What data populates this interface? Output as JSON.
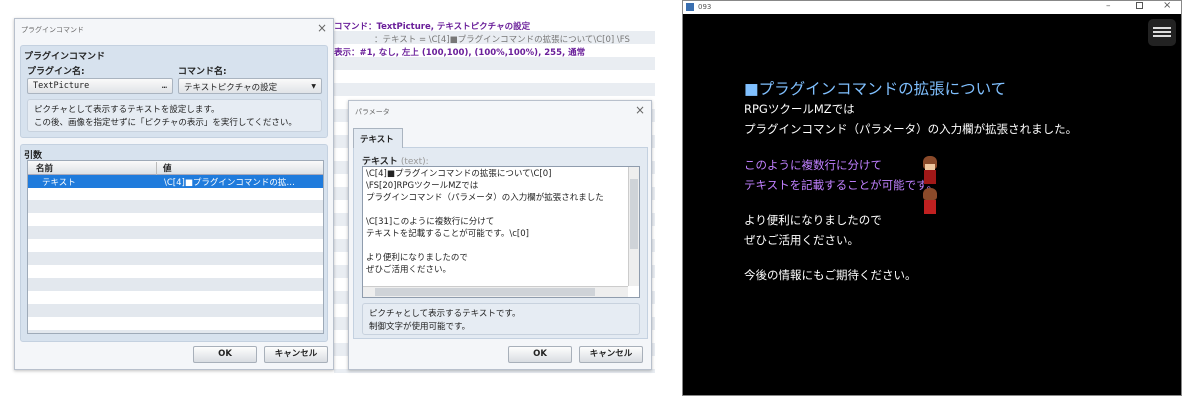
{
  "editor_bg": {
    "lines": [
      "コマンド：TextPicture, テキストピクチャの設定",
      "：テキスト = \\C[4]■プラグインコマンドの拡張について\\C[0] \\FS",
      "表示：#1, なし, 左上 (100,100), (100%,100%), 255, 通常"
    ]
  },
  "plugin_dialog": {
    "title": "プラグインコマンド",
    "section_title": "プラグインコマンド",
    "plugin_label": "プラグイン名:",
    "plugin_value": "TextPicture",
    "plugin_button": "…",
    "command_label": "コマンド名:",
    "command_value": "テキストピクチャの設定",
    "description": [
      "ピクチャとして表示するテキストを設定します。",
      "この後、画像を指定せずに「ピクチャの表示」を実行してください。"
    ],
    "args_title": "引数",
    "columns": [
      "名前",
      "値"
    ],
    "rows": [
      {
        "name": "テキスト",
        "value": "\\C[4]■プラグインコマンドの拡…"
      }
    ],
    "ok": "OK",
    "cancel": "キャンセル"
  },
  "param_dialog": {
    "title": "パラメータ",
    "tab": "テキスト",
    "field_label": "テキスト",
    "field_key": "(text):",
    "text_lines": [
      "\\C[4]■プラグインコマンドの拡張について\\C[0]",
      "\\FS[20]RPGツクールMZでは",
      "プラグインコマンド（パラメータ）の入力欄が拡張されました",
      "",
      "\\C[31]このように複数行に分けて",
      "テキストを記載することが可能です。\\c[0]",
      "",
      "より便利になりましたので",
      "ぜひご活用ください。"
    ],
    "description": [
      "ピクチャとして表示するテキストです。",
      "制御文字が使用可能です。"
    ],
    "ok": "OK",
    "cancel": "キャンセル"
  },
  "game_window": {
    "title": "093",
    "heading": "■プラグインコマンドの拡張について",
    "lines": [
      "RPGツクールMZでは",
      "プラグインコマンド（パラメータ）の入力欄が拡張されました。",
      "このように複数行に分けて",
      "テキストを記載することが可能です。",
      "より便利になりましたので",
      "ぜひご活用ください。",
      "今後の情報にもご期待ください。"
    ],
    "colors": {
      "heading": "#80c0ff",
      "highlight": "#c080ff",
      "text": "#ffffff",
      "background": "#000000"
    }
  }
}
